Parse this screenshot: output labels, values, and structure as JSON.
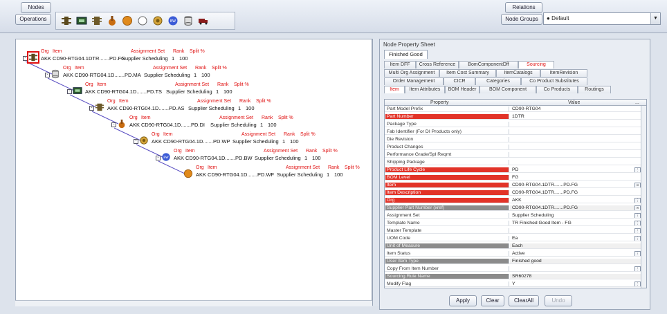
{
  "toolbar": {
    "nodes_label": "Nodes",
    "operations_label": "Operations",
    "relations_label": "Relations",
    "node_groups_label": "Node Groups",
    "relations_value": "Default",
    "icons": [
      "component-icon",
      "board-icon",
      "chip-icon",
      "hand-icon",
      "disc-orange-icon",
      "circle-outline-icon",
      "gear-icon",
      "globe-icon",
      "cylinder-icon",
      "truck-icon"
    ]
  },
  "tree": {
    "header_org": "Org",
    "header_item": "Item",
    "header_assignment": "Assignment Set",
    "header_rank": "Rank",
    "header_split": "Split %",
    "nodes": [
      {
        "org": "AKK",
        "item": "CD90-RTG04.1DTR.......PD.FG",
        "assignment": "Supplier Scheduling",
        "rank": "1",
        "split": "100",
        "icon": "component-icon"
      },
      {
        "org": "AKK",
        "item": "CD90-RTG04.1D.......PD.MA",
        "assignment": "Supplier Scheduling",
        "rank": "1",
        "split": "100",
        "icon": "cylinder-icon"
      },
      {
        "org": "AKK",
        "item": "CD90-RTG04.1D.......PD.TS",
        "assignment": "Supplier Scheduling",
        "rank": "1",
        "split": "100",
        "icon": "board-icon"
      },
      {
        "org": "AKK",
        "item": "CD90-RTG04.1D.......PD.AS",
        "assignment": "Supplier Scheduling",
        "rank": "1",
        "split": "100",
        "icon": "chip-icon"
      },
      {
        "org": "AKK",
        "item": "CD90-RTG04.1D.......PD.DI",
        "assignment": "Supplier Scheduling",
        "rank": "1",
        "split": "100",
        "icon": "hand-icon"
      },
      {
        "org": "AKK",
        "item": "CD90-RTG04.1D.......PD.WP",
        "assignment": "Supplier Scheduling",
        "rank": "1",
        "split": "100",
        "icon": "gear-icon"
      },
      {
        "org": "AKK",
        "item": "CD90-RTG04.1D.......PD.BW",
        "assignment": "Supplier Scheduling",
        "rank": "1",
        "split": "100",
        "icon": "globe-icon"
      },
      {
        "org": "AKK",
        "item": "CD90-RTG04.1D.......PD.WF",
        "assignment": "Supplier Scheduling",
        "rank": "1",
        "split": "100",
        "icon": "disc-orange-icon"
      }
    ]
  },
  "property_sheet": {
    "title": "Node Property Sheet",
    "tab_finished_good": "Finished Good",
    "tab_rows": [
      [
        "Item DFF",
        "Cross Reference",
        "BomComponentDff",
        "Sourcing"
      ],
      [
        "Multi Org Assignment",
        "Item Cost Summary",
        "ItemCatalogs",
        "ItemRevision"
      ],
      [
        "Order Management",
        "CICR",
        "Categories",
        "Co Product Substitutes"
      ],
      [
        "Item",
        "Item Attributes",
        "BOM Header",
        "BOM Component",
        "Co Products",
        "Routings"
      ]
    ],
    "active_tab": "Sourcing",
    "col_property": "Property",
    "col_value": "Value",
    "col_more": "...",
    "rows": [
      {
        "property": "Part Model Prefix",
        "value": "CD90-RTG04",
        "style": "",
        "btn": ""
      },
      {
        "property": "Part Number",
        "value": "1DTR",
        "style": "req",
        "btn": ""
      },
      {
        "property": "Package Type",
        "value": "",
        "style": "",
        "btn": ""
      },
      {
        "property": "Fab Identifier (For DI Products only)",
        "value": "",
        "style": "",
        "btn": ""
      },
      {
        "property": "Die Revision",
        "value": "",
        "style": "",
        "btn": ""
      },
      {
        "property": "Product Changes",
        "value": "",
        "style": "",
        "btn": ""
      },
      {
        "property": "Performance Grade/Spl Reqmt",
        "value": "",
        "style": "",
        "btn": ""
      },
      {
        "property": "Shipping Package",
        "value": "",
        "style": "",
        "btn": ""
      },
      {
        "property": "Product Life Cycle",
        "value": "PD",
        "style": "req",
        "btn": "lov"
      },
      {
        "property": "BOM Level",
        "value": "FG",
        "style": "req",
        "btn": ""
      },
      {
        "property": "Item",
        "value": "CD90-RTG04.1DTR.......PD.FG",
        "style": "req",
        "btn": "link"
      },
      {
        "property": "Item Description",
        "value": "CD90-RTG04.1DTR.......PD.FG",
        "style": "req",
        "btn": ""
      },
      {
        "property": "Org",
        "value": "AKK",
        "style": "req",
        "btn": "lov"
      },
      {
        "property": "Supplier Part Number (xref)",
        "value": "CD90-RTG04.1DTR.......PD.FG",
        "style": "ro",
        "btn": "link"
      },
      {
        "property": "Assignment Set",
        "value": "Supplier Scheduling",
        "style": "",
        "btn": "lov"
      },
      {
        "property": "Template Name",
        "value": "TR Finished Good Item - FG",
        "style": "",
        "btn": "lov"
      },
      {
        "property": "Master Template",
        "value": "",
        "style": "",
        "btn": "lov"
      },
      {
        "property": "UOM Code",
        "value": "Ea",
        "style": "",
        "btn": "lov"
      },
      {
        "property": "Unit of Measure",
        "value": "Each",
        "style": "ro",
        "btn": ""
      },
      {
        "property": "Item Status",
        "value": "Active",
        "style": "",
        "btn": "lov"
      },
      {
        "property": "User Item Type",
        "value": "Finished good",
        "style": "ro",
        "btn": ""
      },
      {
        "property": "Copy From Item Number",
        "value": "",
        "style": "",
        "btn": "lov"
      },
      {
        "property": "Sourcing Rule Name",
        "value": "SR60278",
        "style": "ro",
        "btn": ""
      },
      {
        "property": "Modify Flag",
        "value": "Y",
        "style": "",
        "btn": "lov"
      }
    ],
    "buttons": {
      "apply": "Apply",
      "clear": "Clear",
      "clear_all": "ClearAll",
      "undo": "Undo"
    }
  },
  "colors": {
    "required": "#e23328",
    "readonly": "#8b8b8b",
    "tree_header": "#e01010",
    "connector": "#5a4fc2"
  }
}
